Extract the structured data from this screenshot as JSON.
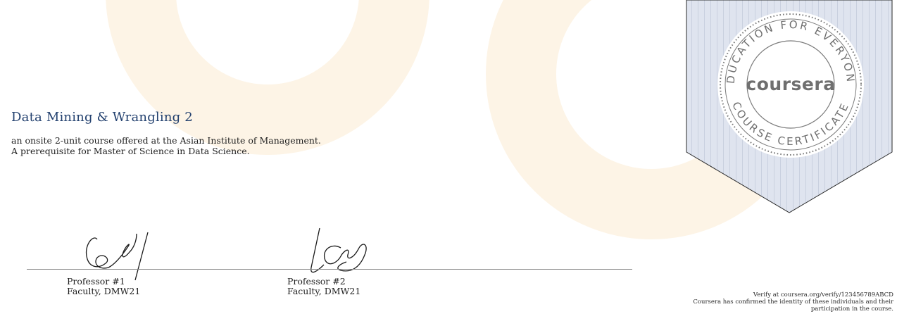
{
  "course": {
    "title": "Data Mining & Wrangling 2",
    "description_line1": "an onsite 2-unit course offered at the Asian Institute of Management.",
    "description_line2": "A prerequisite for Master of Science in Data Science."
  },
  "signatories": [
    {
      "name": "Professor #1",
      "role": "Faculty, DMW21"
    },
    {
      "name": "Professor #2",
      "role": "Faculty, DMW21"
    }
  ],
  "seal": {
    "brand": "coursera",
    "ring_text_top": "EDUCATION FOR EVERYONE",
    "ring_text_bottom": "COURSE CERTIFICATE"
  },
  "verification": {
    "line1": "Verify at coursera.org/verify/123456789ABCD",
    "line2": "Coursera has confirmed the identity of these individuals and their",
    "line3": "participation in the course."
  },
  "colors": {
    "title": "#23416f",
    "ribbon": "#dfe4ef",
    "ribbon_stripe": "#c9d0df",
    "seal": "#6f6f6f",
    "background_ring": "#fdf4e6"
  }
}
